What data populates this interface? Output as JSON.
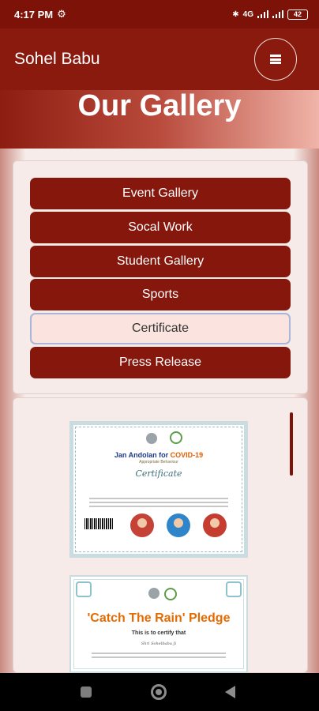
{
  "status_bar": {
    "time": "4:17 PM",
    "network_label": "4G",
    "battery": "42"
  },
  "header": {
    "brand": "Sohel Babu",
    "menu_icon": "hamburger-icon"
  },
  "hero": {
    "title": "Our Gallery"
  },
  "gallery_menu": [
    {
      "label": "Event Gallery",
      "active": false
    },
    {
      "label": "Socal Work",
      "active": false
    },
    {
      "label": "Student Gallery",
      "active": false
    },
    {
      "label": "Sports",
      "active": false
    },
    {
      "label": "Certificate",
      "active": true
    },
    {
      "label": "Press Release",
      "active": false
    }
  ],
  "certificates": [
    {
      "title_prefix": "Jan Andolan for ",
      "title_highlight": "COVID-19",
      "subtitle": "Appropriate Behaviour",
      "heading": "Certificate"
    },
    {
      "title": "'Catch The Rain' Pledge",
      "subtitle": "This is to certify that",
      "salutation": "Shri Sohelbabu Ji"
    }
  ],
  "colors": {
    "primary": "#85170c",
    "header": "#8a1a0d",
    "active_button_bg": "#fbe4e0",
    "page_bg": "#f6ebe8"
  }
}
